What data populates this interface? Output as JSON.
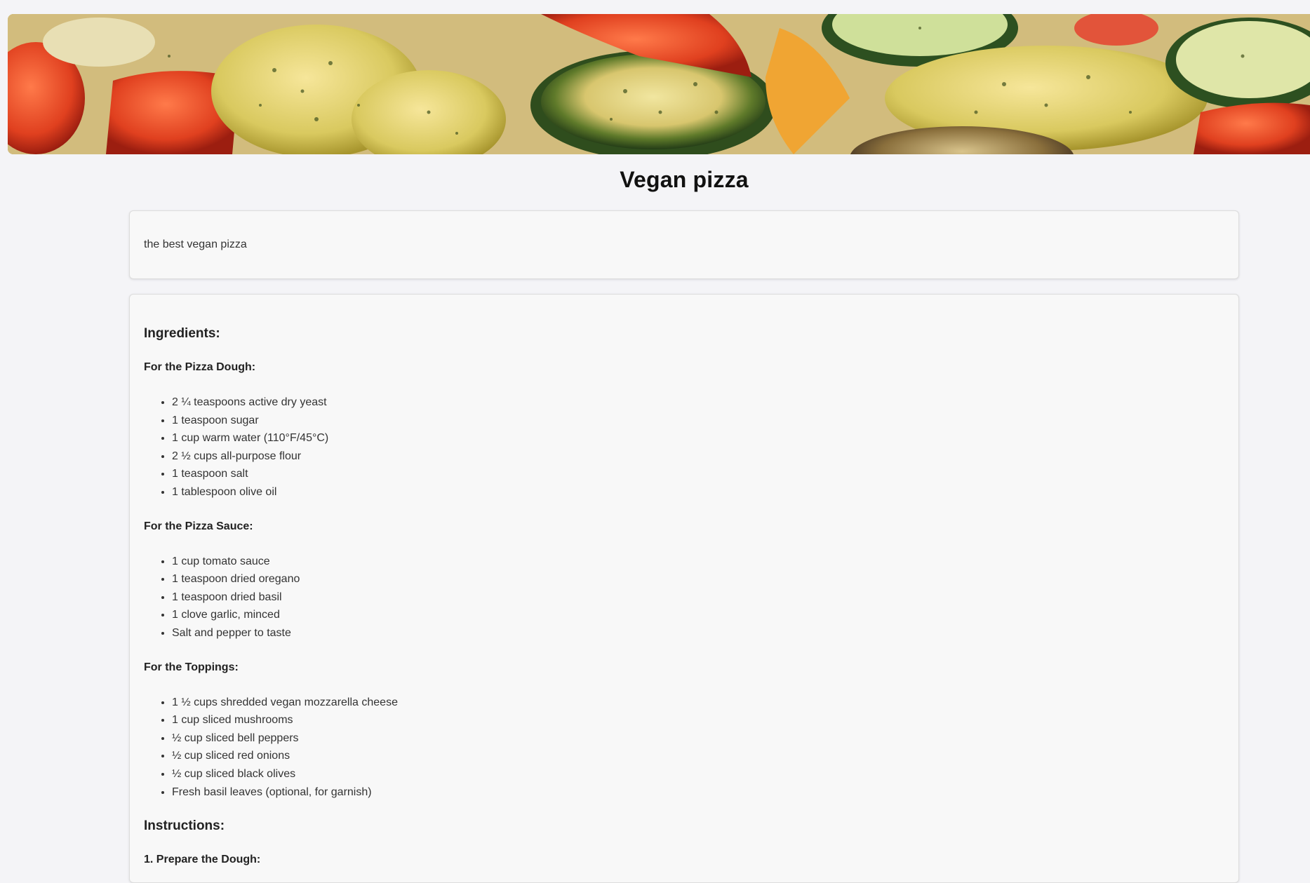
{
  "page": {
    "title": "Vegan pizza",
    "description": "the best vegan pizza"
  },
  "hero": {
    "image_alt": "Roasted vegetables pizza topping"
  },
  "ingredients": {
    "heading": "Ingredients:",
    "dough": {
      "heading": "For the Pizza Dough:",
      "items": [
        "2 ¼ teaspoons active dry yeast",
        "1 teaspoon sugar",
        "1 cup warm water (110°F/45°C)",
        "2 ½ cups all-purpose flour",
        "1 teaspoon salt",
        "1 tablespoon olive oil"
      ]
    },
    "sauce": {
      "heading": "For the Pizza Sauce:",
      "items": [
        "1 cup tomato sauce",
        "1 teaspoon dried oregano",
        "1 teaspoon dried basil",
        "1 clove garlic, minced",
        "Salt and pepper to taste"
      ]
    },
    "toppings": {
      "heading": "For the Toppings:",
      "items": [
        "1 ½ cups shredded vegan mozzarella cheese",
        "1 cup sliced mushrooms",
        "½ cup sliced bell peppers",
        "½ cup sliced red onions",
        "½ cup sliced black olives",
        "Fresh basil leaves (optional, for garnish)"
      ]
    }
  },
  "instructions": {
    "heading": "Instructions:",
    "step1_heading": "1. Prepare the Dough:"
  }
}
